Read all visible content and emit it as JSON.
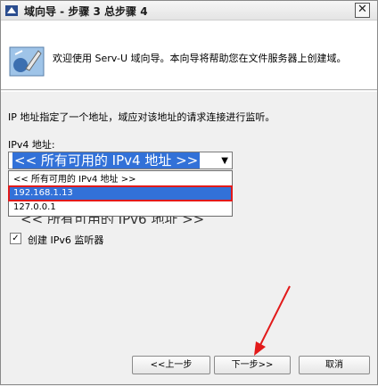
{
  "window": {
    "title": "域向导 - 步骤 3 总步骤 4",
    "close_glyph": "✕"
  },
  "header": {
    "welcome": "欢迎使用 Serv-U 域向导。本向导将帮助您在文件服务器上创建域。"
  },
  "form": {
    "description": "IP 地址指定了一个地址，域应对该地址的请求连接进行监听。",
    "ipv4_label": "IPv4 地址:",
    "ipv4_selected": "<< 所有可用的 IPv4 地址 >>",
    "ipv4_options": [
      "<< 所有可用的 IPv4 地址 >>",
      "192.168.1.13",
      "127.0.0.1"
    ],
    "ipv6_partial": "<< 所有可用的 IPv6 地址 >>",
    "ipv6_checkbox_label": "创建 IPv6 监听器",
    "ipv6_checked": true
  },
  "buttons": {
    "back": "<<上一步",
    "next": "下一步>>",
    "cancel": "取消"
  },
  "colors": {
    "selection": "#3271d8",
    "highlight_box": "#e21a1a",
    "arrow": "#e21a1a"
  }
}
